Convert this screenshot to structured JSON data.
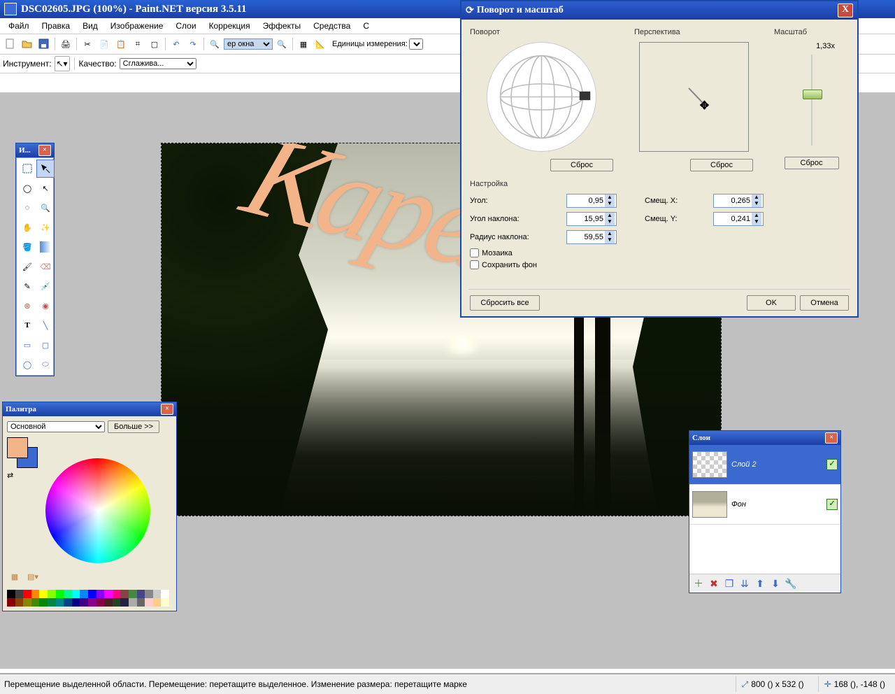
{
  "title": "DSC02605.JPG (100%) - Paint.NET версия 3.5.11",
  "dialog_title": "Поворот и масштаб",
  "menu": [
    "Файл",
    "Правка",
    "Вид",
    "Изображение",
    "Слои",
    "Коррекция",
    "Эффекты",
    "Средства",
    "С"
  ],
  "toolbar2": {
    "tool_lbl": "Инструмент:",
    "quality_lbl": "Качество:",
    "quality_val": "Сглажива...",
    "zoom_val": "ер окна",
    "units_lbl": "Единицы измерения:"
  },
  "status": {
    "hint": "Перемещение выделенной области. Перемещение: перетащите выделенное. Изменение размера: перетащите марке",
    "size": "800 () x 532 ()",
    "pos": "168 (), -148 ()"
  },
  "toolswin_title": "И...",
  "colors": {
    "title": "Палитра",
    "mode": "Основной",
    "more": "Больше >>",
    "primary": "#f4b48a",
    "secondary": "#3a6ad1"
  },
  "layers": {
    "title": "Слои",
    "items": [
      {
        "name": "Слой 2",
        "sel": true,
        "checked": true,
        "thumb": "checker"
      },
      {
        "name": "Фон",
        "sel": false,
        "checked": true,
        "thumb": "img"
      }
    ]
  },
  "dialog": {
    "rotate_lbl": "Поворот",
    "persp_lbl": "Перспектива",
    "scale_lbl": "Масштаб",
    "scale_val": "1,33x",
    "reset": "Сброс",
    "settings_lbl": "Настройка",
    "angle_lbl": "Угол:",
    "angle_val": "0,95",
    "tilt_angle_lbl": "Угол наклона:",
    "tilt_angle_val": "15,95",
    "tilt_radius_lbl": "Радиус наклона:",
    "tilt_radius_val": "59,55",
    "offx_lbl": "Смещ. X:",
    "offx_val": "0,265",
    "offy_lbl": "Смещ. Y:",
    "offy_val": "0,241",
    "tile_lbl": "Мозаика",
    "keepbg_lbl": "Сохранить фон",
    "reset_all": "Сбросить все",
    "ok": "OK",
    "cancel": "Отмена"
  },
  "overlay_text": "Карелия",
  "palette_colors": [
    "#000",
    "#404040",
    "#f00",
    "#f80",
    "#ff0",
    "#8f0",
    "#0f0",
    "#0f8",
    "#0ff",
    "#08f",
    "#00f",
    "#80f",
    "#f0f",
    "#f08",
    "#844",
    "#484",
    "#448",
    "#888",
    "#ccc",
    "#fff",
    "#800",
    "#840",
    "#880",
    "#480",
    "#080",
    "#084",
    "#088",
    "#048",
    "#008",
    "#408",
    "#808",
    "#804",
    "#422",
    "#242",
    "#224",
    "#aaa",
    "#666",
    "#fcc",
    "#fc8",
    "#ffc"
  ]
}
